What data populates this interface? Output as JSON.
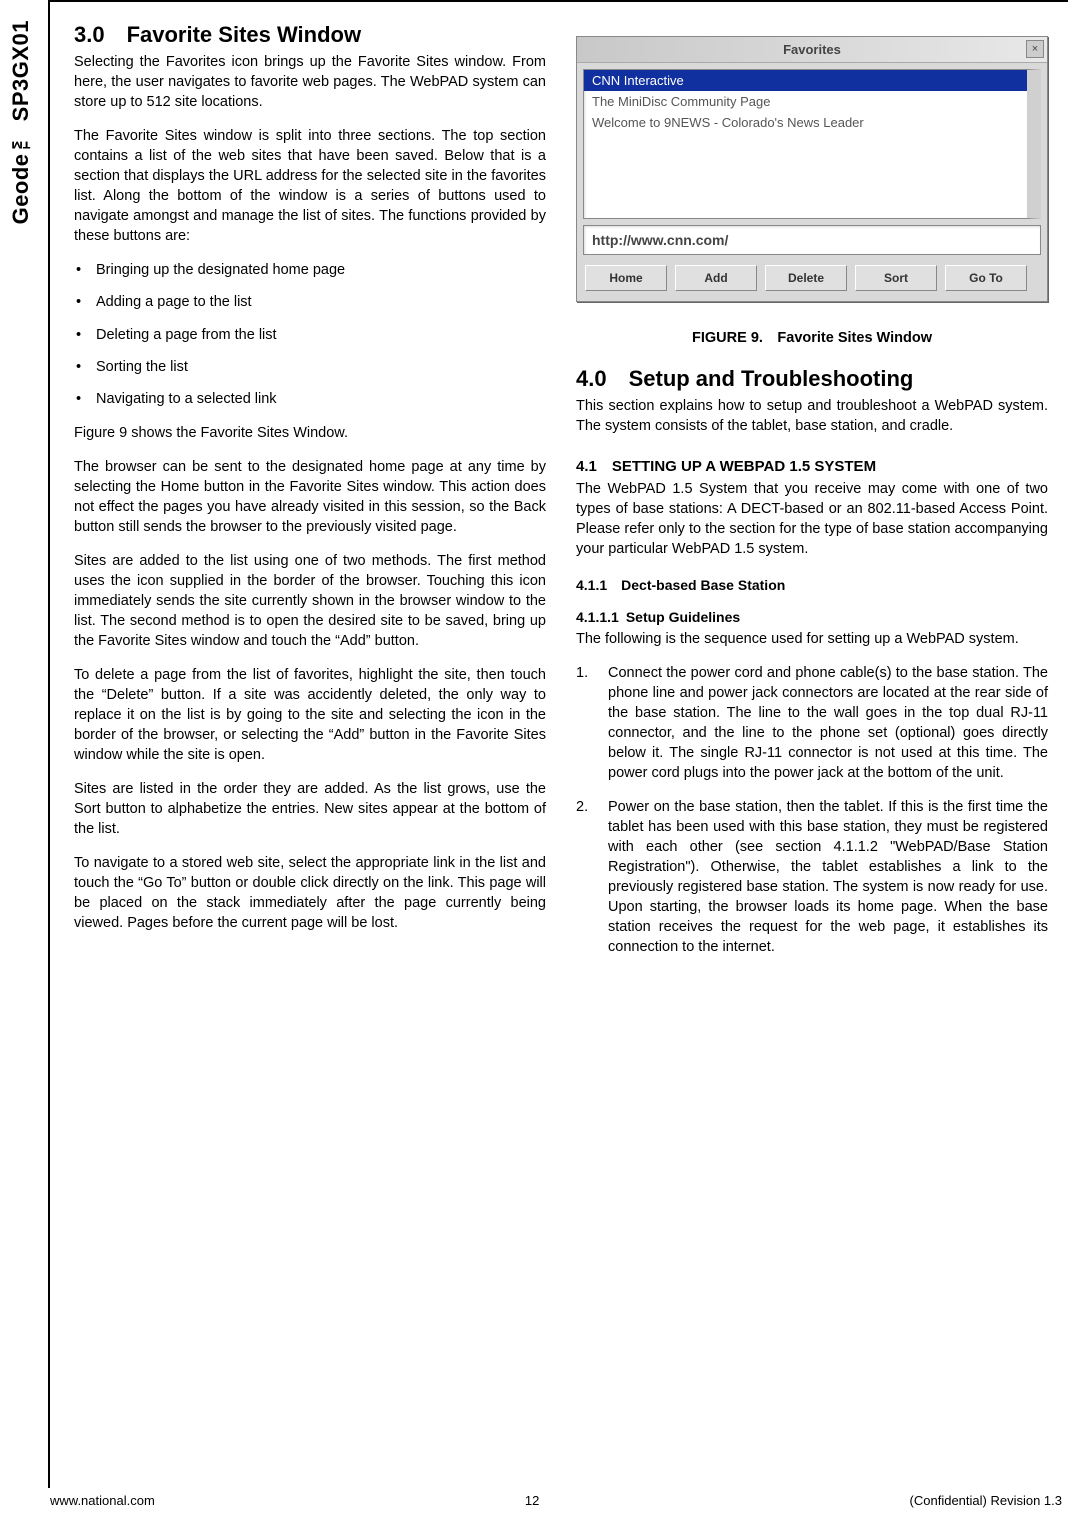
{
  "side_label": "Geode™ SP3GX01",
  "left": {
    "sec3_heading": "3.0 Favorite Sites Window",
    "p1": "Selecting the Favorites icon brings up the Favorite Sites window. From here, the user navigates to favorite web pages. The WebPAD system can store up to 512 site locations.",
    "p2": "The Favorite Sites window is split into three sections. The top section contains a list of the web sites that have been saved. Below that is a section that displays the URL address for the selected site in the favorites list. Along the bottom of the window is a series of buttons used to navigate amongst and manage the list of sites. The functions provided by these buttons are:",
    "bullets": [
      "Bringing up the designated home page",
      "Adding a page to the list",
      "Deleting a page from the list",
      "Sorting the list",
      "Navigating to a selected link"
    ],
    "p3": "Figure 9 shows the Favorite Sites Window.",
    "p4": "The browser can be sent to the designated home page at any time by selecting the Home button in the Favorite Sites window. This action does not effect the pages you have already visited in this session, so the Back button still sends the browser to the previously visited page.",
    "p5": "Sites are added to the list using one of two methods. The first method uses the icon supplied in the border of the browser. Touching this icon immediately sends the site currently shown in the browser window to the list. The second method is to open the desired site to be saved, bring up the Favorite Sites window and touch the “Add” button.",
    "p6": "To delete a page from the list of favorites, highlight the site, then touch the “Delete” button. If a site was accidently deleted, the only way to replace it on the list is by going to the site and selecting the icon in the border of the browser, or selecting the “Add” button in the Favorite Sites window while the site is open.",
    "p7": "Sites are listed in the order they are added. As the list grows, use the Sort button to alphabetize the entries. New sites appear at the bottom of the list.",
    "p8": "To navigate to a stored web site, select the appropriate link in the list and touch the “Go To” button or double click directly on the link. This page will be placed on the stack immediately after the page currently being viewed. Pages before the current page will be lost."
  },
  "fig": {
    "titlebar": "Favorites",
    "close": "×",
    "items": [
      "CNN Interactive",
      "The MiniDisc Community Page",
      "Welcome to 9NEWS - Colorado's News Leader"
    ],
    "url": "http://www.cnn.com/",
    "buttons": {
      "home": "Home",
      "add": "Add",
      "delete": "Delete",
      "sort": "Sort",
      "goto": "Go To"
    },
    "caption": "FIGURE 9. Favorite Sites Window"
  },
  "right": {
    "sec4_heading": "4.0 Setup and Troubleshooting",
    "p1": "This section explains how to setup and troubleshoot a WebPAD system. The system consists of the tablet, base station, and cradle.",
    "h41": "4.1 SETTING UP A WEBPAD 1.5 SYSTEM",
    "p41": "The WebPAD 1.5 System that you receive may come with one of two types of base stations: A DECT-based or an 802.11-based Access Point. Please refer only to the section for the type of base station accompanying your particular WebPAD 1.5 system.",
    "h411": "4.1.1 Dect-based Base Station",
    "h4111": "4.1.1.1 Setup Guidelines",
    "p4111": "The following is the sequence used for setting up a WebPAD system.",
    "steps": [
      "Connect the power cord and phone cable(s) to the base station. The phone line and power jack connectors are located at the rear side of the base station. The line to the wall goes in the top dual RJ-11 connector, and the line to the phone set (optional) goes directly below it. The single RJ-11 connector is not used at this time. The power cord plugs into the power jack at the bottom of the unit.",
      "Power on the base station, then the tablet. If this is the first time the tablet has been used with this base station, they must be registered with each other (see section 4.1.1.2 \"WebPAD/Base Station Registration\"). Otherwise, the tablet establishes a link to the previously registered base station. The system is now ready for use. Upon starting, the browser loads its home page. When the base station receives the request for the web page, it establishes its connection to the internet."
    ]
  },
  "footer": {
    "left": "www.national.com",
    "center": "12",
    "right": "(Confidential) Revision 1.3"
  }
}
